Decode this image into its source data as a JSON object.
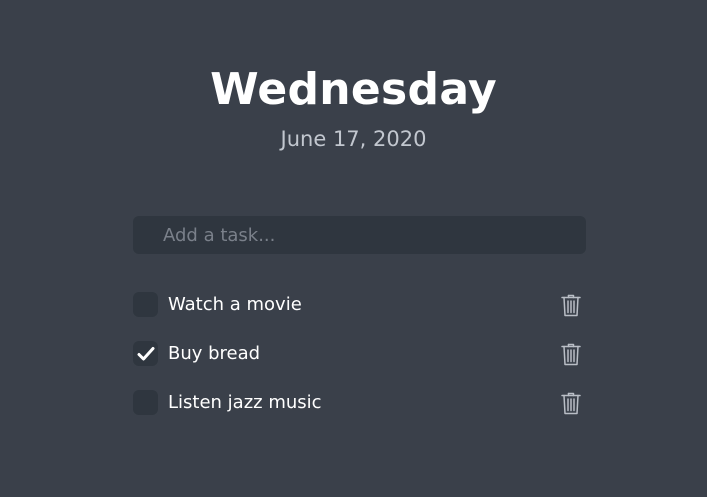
{
  "header": {
    "day": "Wednesday",
    "date": "June 17, 2020"
  },
  "task_input": {
    "placeholder": "Add a task...",
    "value": ""
  },
  "tasks": [
    {
      "label": "Watch a movie",
      "checked": false,
      "checkbox_icon": "check-icon",
      "delete_icon": "trash-icon"
    },
    {
      "label": "Buy bread",
      "checked": true,
      "checkbox_icon": "check-icon",
      "delete_icon": "trash-icon"
    },
    {
      "label": "Listen jazz music",
      "checked": false,
      "checkbox_icon": "check-icon",
      "delete_icon": "trash-icon"
    }
  ],
  "colors": {
    "background": "#3a404a",
    "input_background": "#2f363f",
    "text": "#ffffff",
    "muted_text": "#c2c7cf",
    "icon": "#b9bec6"
  }
}
